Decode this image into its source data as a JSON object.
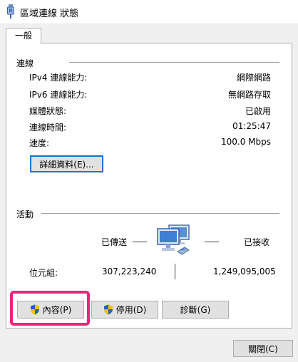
{
  "window": {
    "title": "區域連線 狀態",
    "icon": "network-adapter-icon"
  },
  "tabs": [
    {
      "label": "一般"
    }
  ],
  "connection": {
    "label": "連線",
    "rows": [
      {
        "label": "IPv4 連線能力:",
        "value": "網際網路"
      },
      {
        "label": "IPv6 連線能力:",
        "value": "無網路存取"
      },
      {
        "label": "媒體狀態:",
        "value": "已啟用"
      },
      {
        "label": "連線時間:",
        "value": "01:25:47"
      },
      {
        "label": "速度:",
        "value": "100.0 Mbps"
      }
    ],
    "details_button": "詳細資料(E)..."
  },
  "activity": {
    "label": "活動",
    "sent_label": "已傳送",
    "received_label": "已接收",
    "bytes_label": "位元組:",
    "bytes_sent": "307,223,240",
    "bytes_received": "1,249,095,005",
    "icon": "network-computers-icon"
  },
  "buttons": {
    "properties": "內容(P)",
    "disable": "停用(D)",
    "diagnose": "診斷(G)",
    "close": "關閉(C)"
  },
  "colors": {
    "highlight": "#f0247a",
    "focus_border": "#0078d7",
    "shield_blue": "#2b5fb4",
    "shield_yellow": "#f3c20d"
  }
}
